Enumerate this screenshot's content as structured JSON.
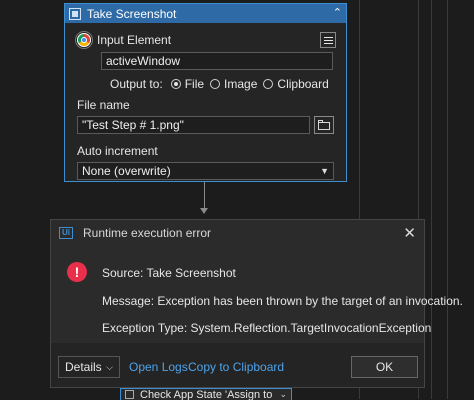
{
  "activity": {
    "title": "Take Screenshot",
    "input_element_label": "Input Element",
    "window_value": "activeWindow",
    "output_to_label": "Output to:",
    "output_options": [
      "File",
      "Image",
      "Clipboard"
    ],
    "output_selected": "File",
    "file_name_label": "File name",
    "file_name_value": "\"Test Step # 1.png\"",
    "auto_increment_label": "Auto increment",
    "auto_increment_value": "None (overwrite)"
  },
  "dialog": {
    "logo_text": "Ui",
    "title": "Runtime execution error",
    "source": "Source: Take Screenshot",
    "message": "Message: Exception has been thrown by the target of an invocation.",
    "exception_type": "Exception Type: System.Reflection.TargetInvocationException",
    "details_label": "Details",
    "open_logs_label": "Open Logs",
    "copy_label": "Copy to Clipboard",
    "ok_label": "OK"
  },
  "next_activity": {
    "title": "Check App State 'Assign to"
  },
  "colors": {
    "accent": "#3d8fd1",
    "header": "#2e6aa6",
    "error": "#e8304a",
    "link": "#4ea3ea"
  }
}
